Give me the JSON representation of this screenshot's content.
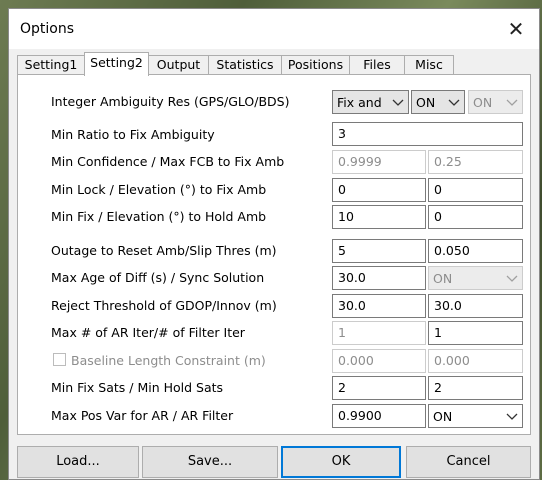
{
  "window": {
    "title": "Options",
    "close_glyph": "✕"
  },
  "tabs": [
    "Setting1",
    "Setting2",
    "Output",
    "Statistics",
    "Positions",
    "Files",
    "Misc"
  ],
  "active_tab": "Setting2",
  "rows": {
    "ambiguity": {
      "label": "Integer Ambiguity Res (GPS/GLO/BDS)",
      "gps": "Fix and Hold",
      "glo": "ON",
      "bds": "ON"
    },
    "min_ratio": {
      "label": "Min Ratio to Fix Ambiguity",
      "value": "3"
    },
    "min_conf": {
      "label": "Min Confidence / Max FCB to Fix Amb",
      "value1": "0.9999",
      "value2": "0.25"
    },
    "min_lock": {
      "label": "Min Lock / Elevation (°) to Fix Amb",
      "value1": "0",
      "value2": "0"
    },
    "min_fix": {
      "label": "Min Fix / Elevation (°) to Hold Amb",
      "value1": "10",
      "value2": "0"
    },
    "outage": {
      "label": "Outage to Reset Amb/Slip Thres (m)",
      "value1": "5",
      "value2": "0.050"
    },
    "max_age": {
      "label": "Max Age of Diff (s) / Sync Solution",
      "value1": "30.0",
      "value2": "ON"
    },
    "reject": {
      "label": "Reject Threshold of GDOP/Innov (m)",
      "value1": "30.0",
      "value2": "30.0"
    },
    "ar_iter": {
      "label": "Max # of AR Iter/# of Filter Iter",
      "value1": "1",
      "value2": "1"
    },
    "baseline": {
      "label": "Baseline Length Constraint (m)",
      "checked": false,
      "value1": "0.000",
      "value2": "0.000"
    },
    "fix_sats": {
      "label": "Min Fix Sats / Min Hold Sats",
      "value1": "2",
      "value2": "2"
    },
    "pos_var": {
      "label": "Max Pos Var for AR / AR Filter",
      "value1": "0.9900",
      "value2": "ON"
    }
  },
  "buttons": {
    "load": "Load...",
    "save": "Save...",
    "ok": "OK",
    "cancel": "Cancel"
  },
  "colors": {
    "accent": "#0078d7"
  }
}
